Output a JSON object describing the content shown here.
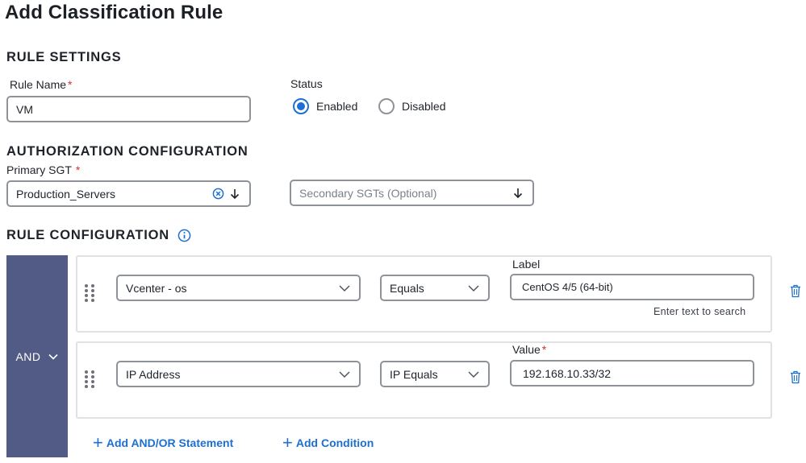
{
  "page": {
    "title": "Add Classification Rule"
  },
  "rule_settings": {
    "section_title": "RULE SETTINGS",
    "rule_name_label": "Rule Name",
    "rule_name_value": "VM",
    "status_label": "Status",
    "status_options": [
      {
        "label": "Enabled",
        "selected": true
      },
      {
        "label": "Disabled",
        "selected": false
      }
    ]
  },
  "authorization": {
    "section_title": "AUTHORIZATION CONFIGURATION",
    "primary_sgt_label": "Primary SGT",
    "primary_sgt_value": "Production_Servers",
    "secondary_sgt_placeholder": "Secondary SGTs (Optional)"
  },
  "rule_configuration": {
    "section_title": "RULE CONFIGURATION",
    "operator": "AND",
    "conditions": [
      {
        "attribute": "Vcenter - os",
        "comparator": "Equals",
        "value_label": "Label",
        "value": "CentOS 4/5 (64-bit)",
        "hint": "Enter text to search"
      },
      {
        "attribute": "IP Address",
        "comparator": "IP Equals",
        "value_label": "Value",
        "value": "192.168.10.33/32"
      }
    ],
    "add_statement_label": "Add AND/OR Statement",
    "add_condition_label": "Add Condition"
  },
  "colors": {
    "accent": "#1d6fd1",
    "operator_panel": "#515b86",
    "required": "#d0302f"
  }
}
